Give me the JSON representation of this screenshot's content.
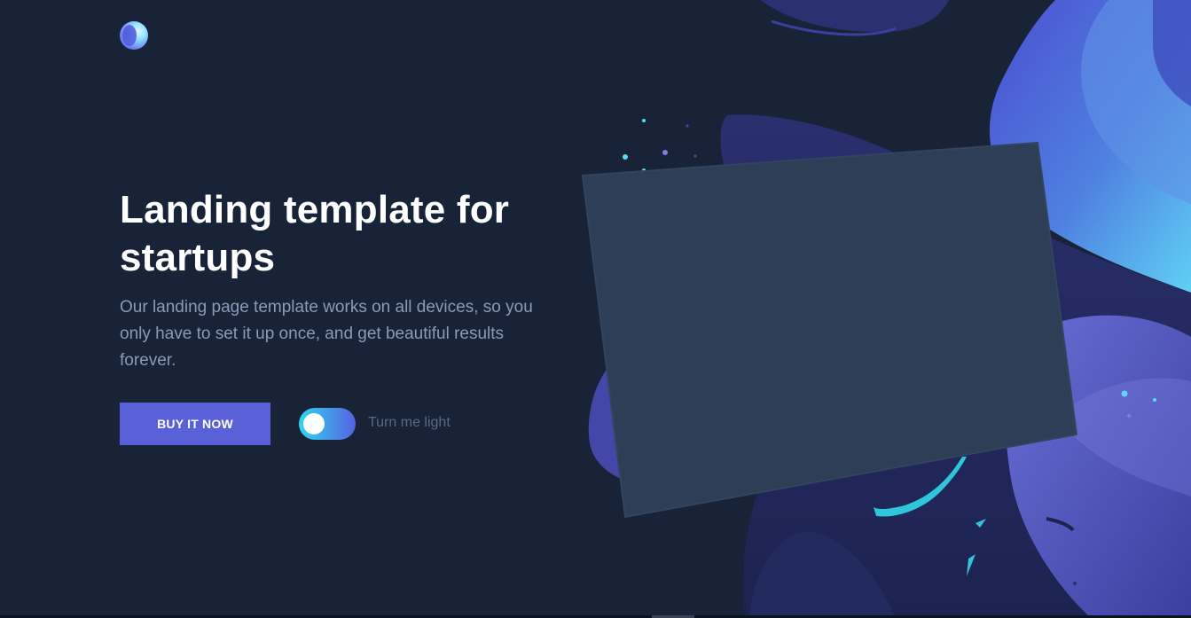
{
  "brand": {
    "logo_icon": "sphere-logo-icon"
  },
  "hero": {
    "title": "Landing template for startups",
    "paragraph": "Our landing page template works on all devices, so you only have to set it up once, and get beautiful results forever."
  },
  "cta": {
    "buy_label": "BUY IT NOW"
  },
  "toggle": {
    "label": "Turn me light",
    "state": "dark"
  },
  "colors": {
    "background": "#182337",
    "accent": "#5a61d8",
    "toggle_start": "#2fd6f2",
    "device": "#2e3e57"
  }
}
